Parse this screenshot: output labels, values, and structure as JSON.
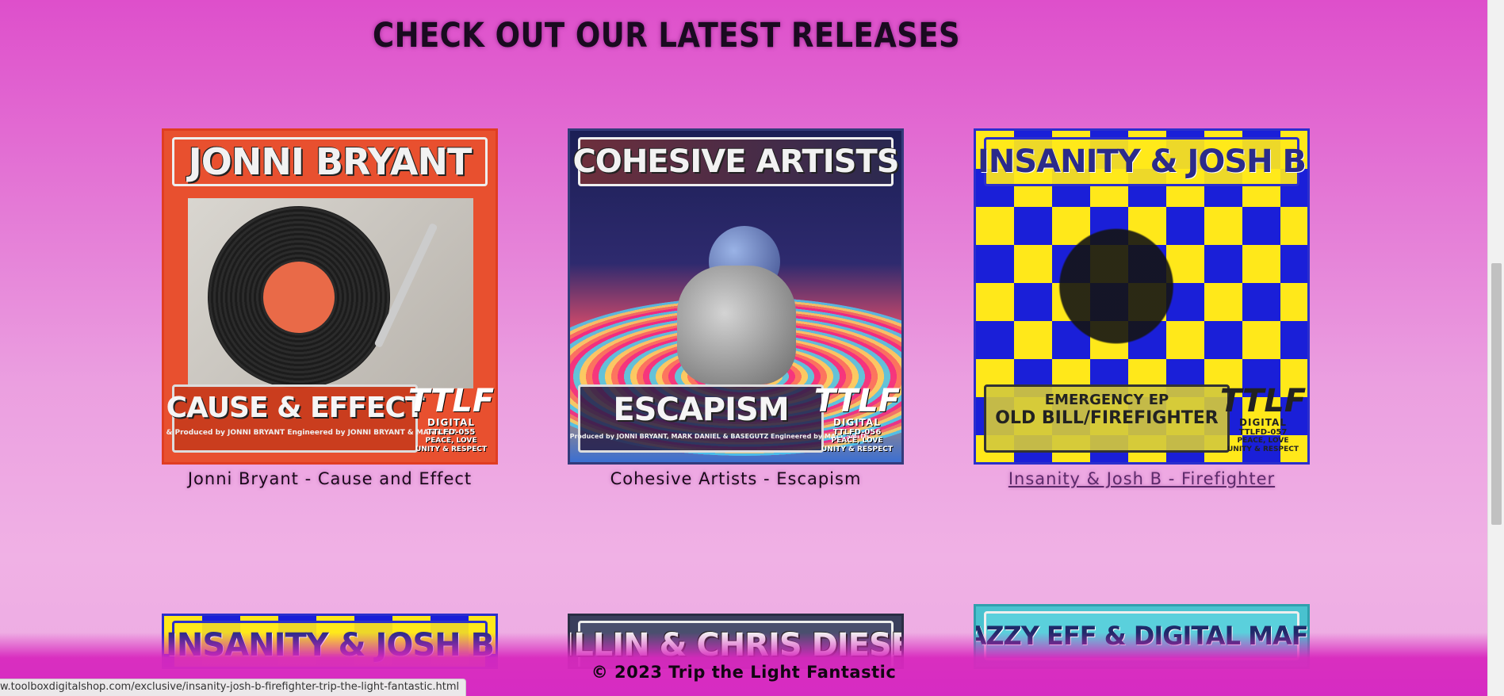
{
  "section": {
    "heading": "CHECK OUT OUR LATEST RELEASES"
  },
  "releases": [
    {
      "caption": "Jonni Bryant - Cause and Effect",
      "cover": {
        "artist": "JONNI BRYANT",
        "title": "CAUSE & EFFECT",
        "credits": "Written & Produced by JONNI BRYANT   Engineered by JONNI BRYANT & MANIKINZ",
        "catalog": "TTLFD-055"
      }
    },
    {
      "caption": "Cohesive Artists - Escapism",
      "cover": {
        "artist": "COHESIVE ARTISTS",
        "title": "ESCAPISM",
        "credits": "Written & Produced by JONNI BRYANT, MARK DANIEL & BASEGUTZ   Engineered by MATT SMITH",
        "catalog": "TTLFD-056"
      }
    },
    {
      "caption": "Insanity & Josh B - Firefighter",
      "link": true,
      "cover": {
        "artist": "INSANITY & JOSH B",
        "title": "EMERGENCY EP",
        "subtitle": "OLD BILL/FIREFIGHTER",
        "catalog": "TTLFD-057"
      }
    }
  ],
  "releases_row2": [
    {
      "artist": "INSANITY & JOSH B"
    },
    {
      "artist": "ZILLIN & CHRIS DIESEL"
    },
    {
      "artist": "KAZZY EFF & DIGITAL MAFIA"
    }
  ],
  "label_logo": {
    "mark": "TTLF",
    "digital": "DIGITAL",
    "motto": "PEACE, LOVE UNITY & RESPECT"
  },
  "footer": {
    "copyright": "© 2023 Trip the Light Fantastic"
  },
  "status_bar": {
    "url": "w.toolboxdigitalshop.com/exclusive/insanity-josh-b-firefighter-trip-the-light-fantastic.html"
  },
  "colors": {
    "background_top": "#de4fcb",
    "background_bottom": "#f0b1e5",
    "footer": "#d62bc2"
  }
}
